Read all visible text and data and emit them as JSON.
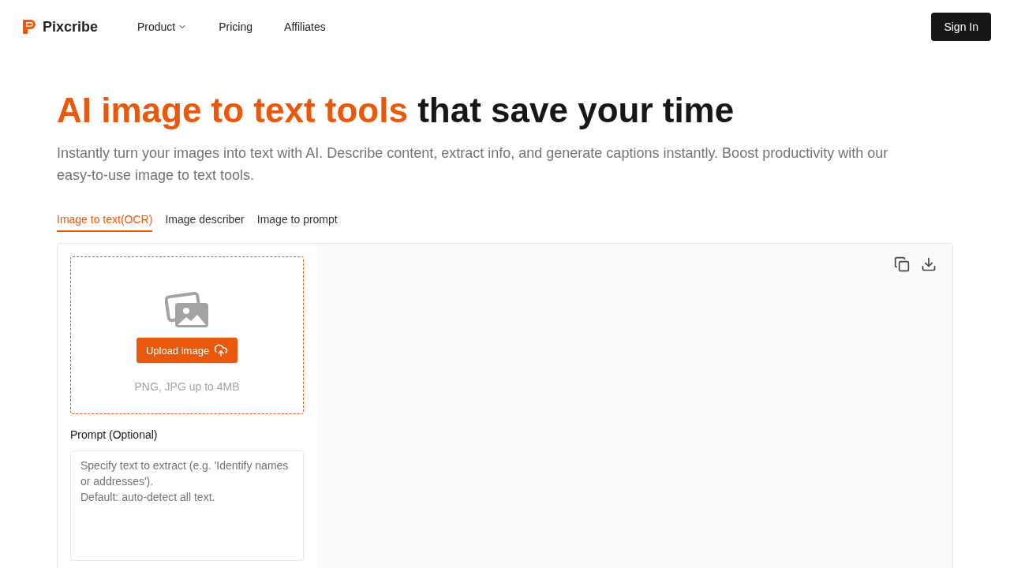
{
  "brand": {
    "name": "Pixcribe"
  },
  "nav": [
    {
      "label": "Product",
      "dropdown": true
    },
    {
      "label": "Pricing",
      "dropdown": false
    },
    {
      "label": "Affiliates",
      "dropdown": false
    }
  ],
  "sign_in": "Sign In",
  "headline": {
    "highlight": "AI image to text tools",
    "rest": "that save your time"
  },
  "subtitle": "Instantly turn your images into text with AI. Describe content, extract info, and generate captions instantly. Boost productivity with our easy-to-use image to text tools.",
  "tabs": [
    {
      "label": "Image to text(OCR)",
      "selected": true
    },
    {
      "label": "Image describer",
      "selected": false
    },
    {
      "label": "Image to prompt",
      "selected": false
    }
  ],
  "upload": {
    "button": "Upload image",
    "hint": "PNG, JPG up to 4MB"
  },
  "prompt": {
    "label": "Prompt (Optional)",
    "placeholder": "Specify text to extract (e.g. 'Identify names or addresses').\nDefault: auto-detect all text."
  }
}
